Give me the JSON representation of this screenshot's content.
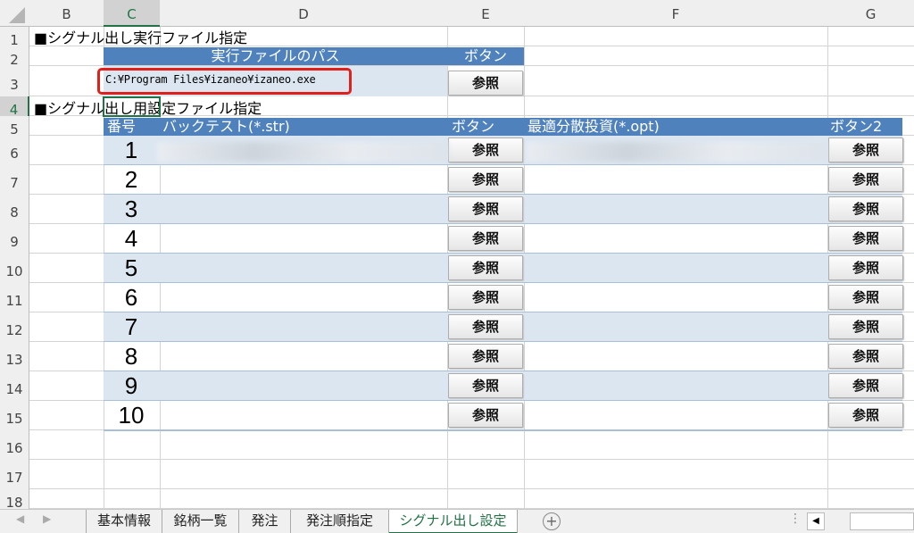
{
  "columns": [
    "B",
    "C",
    "D",
    "E",
    "F",
    "G"
  ],
  "rows": [
    "1",
    "2",
    "3",
    "4",
    "5",
    "6",
    "7",
    "8",
    "9",
    "10",
    "11",
    "12",
    "13",
    "14",
    "15",
    "16",
    "17",
    "18"
  ],
  "section1": {
    "title": "■シグナル出し実行ファイル指定",
    "path_header": "実行ファイルのパス",
    "button_header": "ボタン",
    "path_value": "C:¥Program Files¥izaneo¥izaneo.exe",
    "browse_label": "参照"
  },
  "section2": {
    "title": "■シグナル出し用設定ファイル指定",
    "headers": {
      "number": "番号",
      "backtest": "バックテスト(*.str)",
      "button": "ボタン",
      "optimal": "最適分散投資(*.opt)",
      "button2": "ボタン2"
    },
    "numbers": [
      "1",
      "2",
      "3",
      "4",
      "5",
      "6",
      "7",
      "8",
      "9",
      "10"
    ],
    "browse_label": "参照"
  },
  "sheet_tabs": [
    "基本情報",
    "銘柄一覧",
    "発注",
    "発注順指定",
    "シグナル出し設定"
  ],
  "active_tab": "シグナル出し設定",
  "colors": {
    "header_blue": "#4f81bd",
    "band": "#dce6f1",
    "highlight_red": "#e0201b",
    "excel_green": "#217346"
  }
}
